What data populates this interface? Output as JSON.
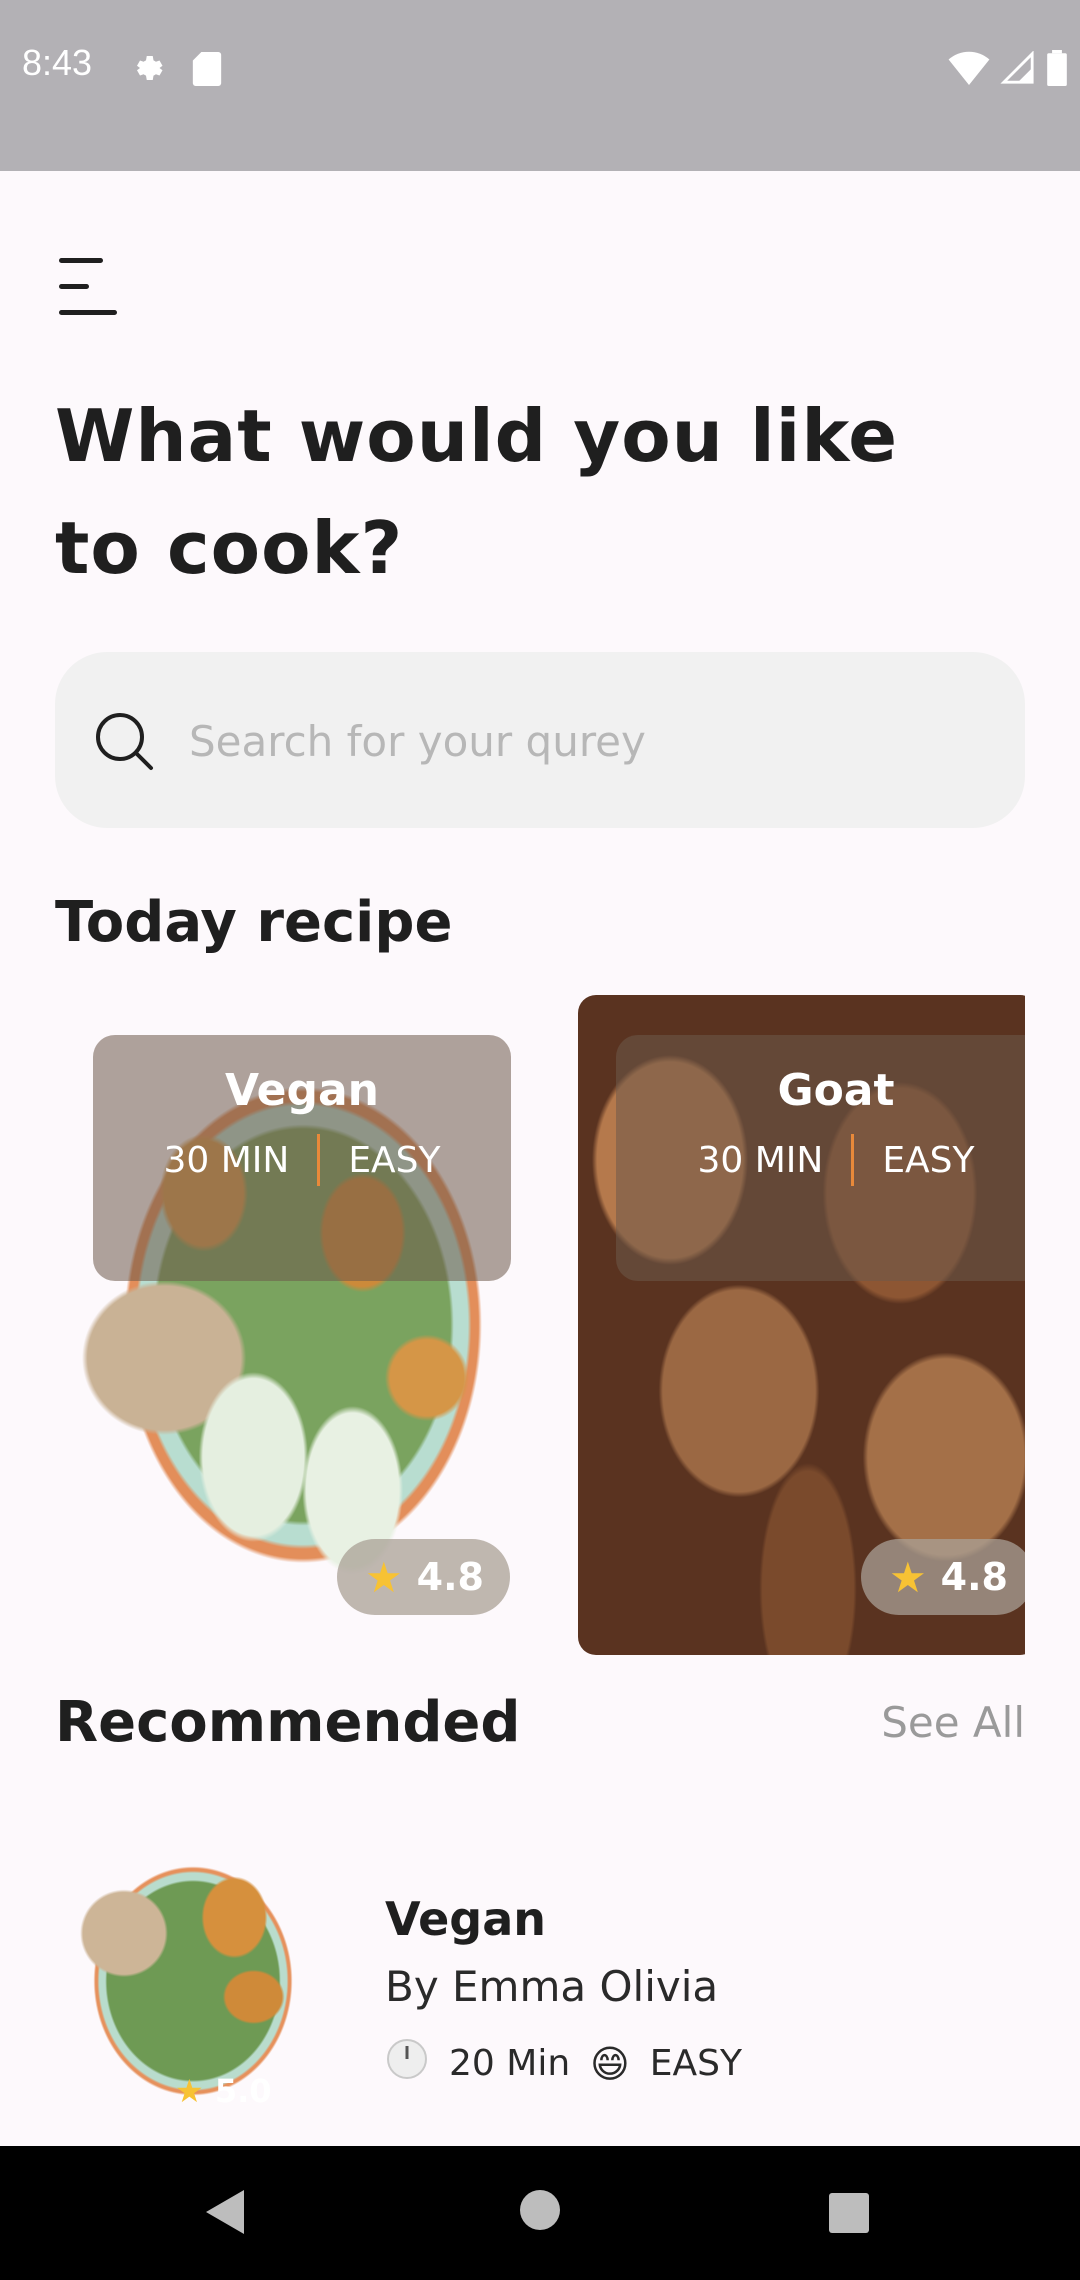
{
  "status_bar": {
    "time": "8:43"
  },
  "header": {
    "title": "What would you like to cook?"
  },
  "search": {
    "placeholder": "Search for your qurey"
  },
  "today": {
    "section_title": "Today recipe",
    "cards": [
      {
        "name": "Vegan",
        "time": "30 MIN",
        "difficulty": "EASY",
        "rating": "4.8"
      },
      {
        "name": "Goat",
        "time": "30 MIN",
        "difficulty": "EASY",
        "rating": "4.8"
      }
    ]
  },
  "recommended": {
    "section_title": "Recommended",
    "see_all": "See All",
    "items": [
      {
        "name": "Vegan",
        "author": "By Emma Olivia",
        "time": "20 Min",
        "difficulty": "EASY",
        "rating": "5.0"
      }
    ]
  },
  "colors": {
    "background": "#fdf9fc",
    "accent": "#e8893a",
    "star": "#f7c234",
    "search_bg": "#f1f1f1"
  }
}
